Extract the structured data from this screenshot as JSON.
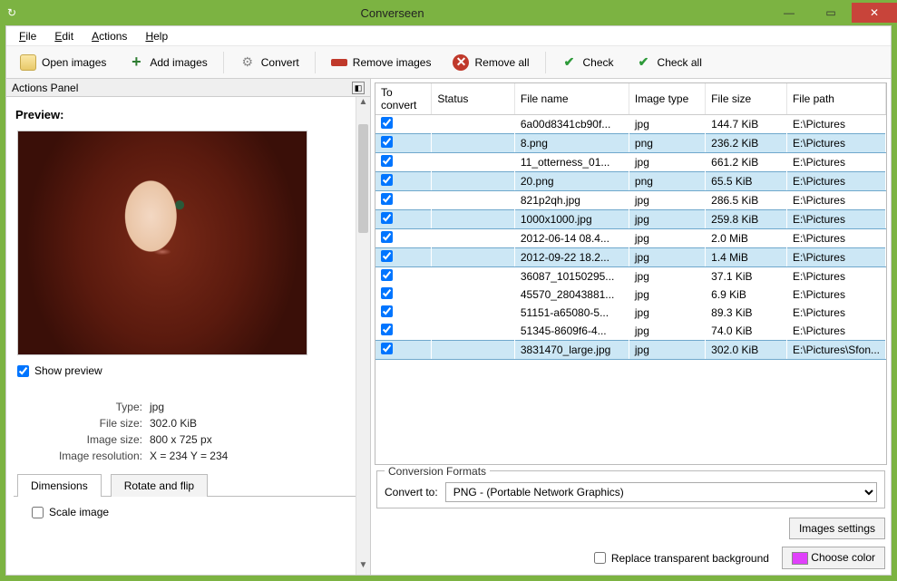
{
  "window": {
    "title": "Converseen"
  },
  "menus": {
    "file": "File",
    "edit": "Edit",
    "actions": "Actions",
    "help": "Help"
  },
  "toolbar": {
    "open": "Open images",
    "add": "Add images",
    "convert": "Convert",
    "remove": "Remove images",
    "removeall": "Remove all",
    "check": "Check",
    "checkall": "Check all"
  },
  "actions_panel": {
    "title": "Actions Panel"
  },
  "preview": {
    "heading": "Preview:",
    "show_label": "Show preview",
    "show_checked": true,
    "meta": {
      "type_k": "Type:",
      "type_v": "jpg",
      "filesize_k": "File size:",
      "filesize_v": "302.0 KiB",
      "imagesize_k": "Image size:",
      "imagesize_v": "800 x 725 px",
      "res_k": "Image resolution:",
      "res_v": "X = 234 Y = 234"
    },
    "tabs": {
      "dim": "Dimensions",
      "rot": "Rotate and flip"
    },
    "scale_label": "Scale image"
  },
  "table": {
    "cols": {
      "toconvert": "To convert",
      "status": "Status",
      "filename": "File name",
      "imagetype": "Image type",
      "filesize": "File size",
      "filepath": "File path"
    },
    "rows": [
      {
        "checked": true,
        "sel": false,
        "filename": "6a00d8341cb90f...",
        "type": "jpg",
        "size": "144.7 KiB",
        "path": "E:\\Pictures"
      },
      {
        "checked": true,
        "sel": true,
        "filename": "8.png",
        "type": "png",
        "size": "236.2 KiB",
        "path": "E:\\Pictures"
      },
      {
        "checked": true,
        "sel": false,
        "filename": "11_otterness_01...",
        "type": "jpg",
        "size": "661.2 KiB",
        "path": "E:\\Pictures"
      },
      {
        "checked": true,
        "sel": true,
        "filename": "20.png",
        "type": "png",
        "size": "65.5 KiB",
        "path": "E:\\Pictures"
      },
      {
        "checked": true,
        "sel": false,
        "filename": "821p2qh.jpg",
        "type": "jpg",
        "size": "286.5 KiB",
        "path": "E:\\Pictures"
      },
      {
        "checked": true,
        "sel": true,
        "filename": "1000x1000.jpg",
        "type": "jpg",
        "size": "259.8 KiB",
        "path": "E:\\Pictures"
      },
      {
        "checked": true,
        "sel": false,
        "filename": "2012-06-14 08.4...",
        "type": "jpg",
        "size": "2.0 MiB",
        "path": "E:\\Pictures"
      },
      {
        "checked": true,
        "sel": true,
        "filename": "2012-09-22 18.2...",
        "type": "jpg",
        "size": "1.4 MiB",
        "path": "E:\\Pictures"
      },
      {
        "checked": true,
        "sel": false,
        "filename": "36087_10150295...",
        "type": "jpg",
        "size": "37.1 KiB",
        "path": "E:\\Pictures"
      },
      {
        "checked": true,
        "sel": false,
        "filename": "45570_28043881...",
        "type": "jpg",
        "size": "6.9 KiB",
        "path": "E:\\Pictures"
      },
      {
        "checked": true,
        "sel": false,
        "filename": "51151-a65080-5...",
        "type": "jpg",
        "size": "89.3 KiB",
        "path": "E:\\Pictures"
      },
      {
        "checked": true,
        "sel": false,
        "filename": "51345-8609f6-4...",
        "type": "jpg",
        "size": "74.0 KiB",
        "path": "E:\\Pictures"
      },
      {
        "checked": true,
        "sel": true,
        "filename": "3831470_large.jpg",
        "type": "jpg",
        "size": "302.0 KiB",
        "path": "E:\\Pictures\\Sfon..."
      }
    ]
  },
  "conversion": {
    "group": "Conversion Formats",
    "convert_to": "Convert to:",
    "selected": "PNG - (Portable Network Graphics)",
    "images_settings": "Images settings",
    "replace_bg": "Replace transparent background",
    "choose_color": "Choose color",
    "color": "#e040fb"
  }
}
